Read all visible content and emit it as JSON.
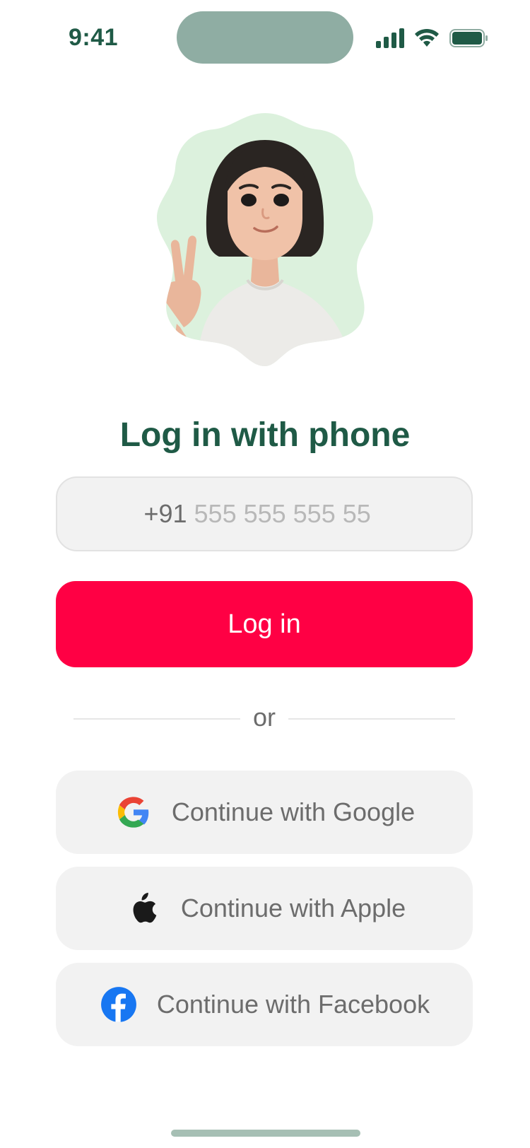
{
  "status_bar": {
    "time": "9:41",
    "icons": [
      "signal-icon",
      "wifi-icon",
      "battery-icon"
    ],
    "accent": "#1f5a46"
  },
  "avatar": {
    "icon": "avatar-peace-sign",
    "bg_color": "#dcf1dd"
  },
  "title": "Log in with phone",
  "phone": {
    "prefix": "+91",
    "placeholder": "555 555 555 55",
    "value": ""
  },
  "login_button": {
    "label": "Log in",
    "color": "#ff0044"
  },
  "divider_text": "or",
  "social": {
    "google": {
      "label": "Continue with Google",
      "icon": "google-icon"
    },
    "apple": {
      "label": "Continue with Apple",
      "icon": "apple-icon"
    },
    "facebook": {
      "label": "Continue with Facebook",
      "icon": "facebook-icon"
    }
  }
}
